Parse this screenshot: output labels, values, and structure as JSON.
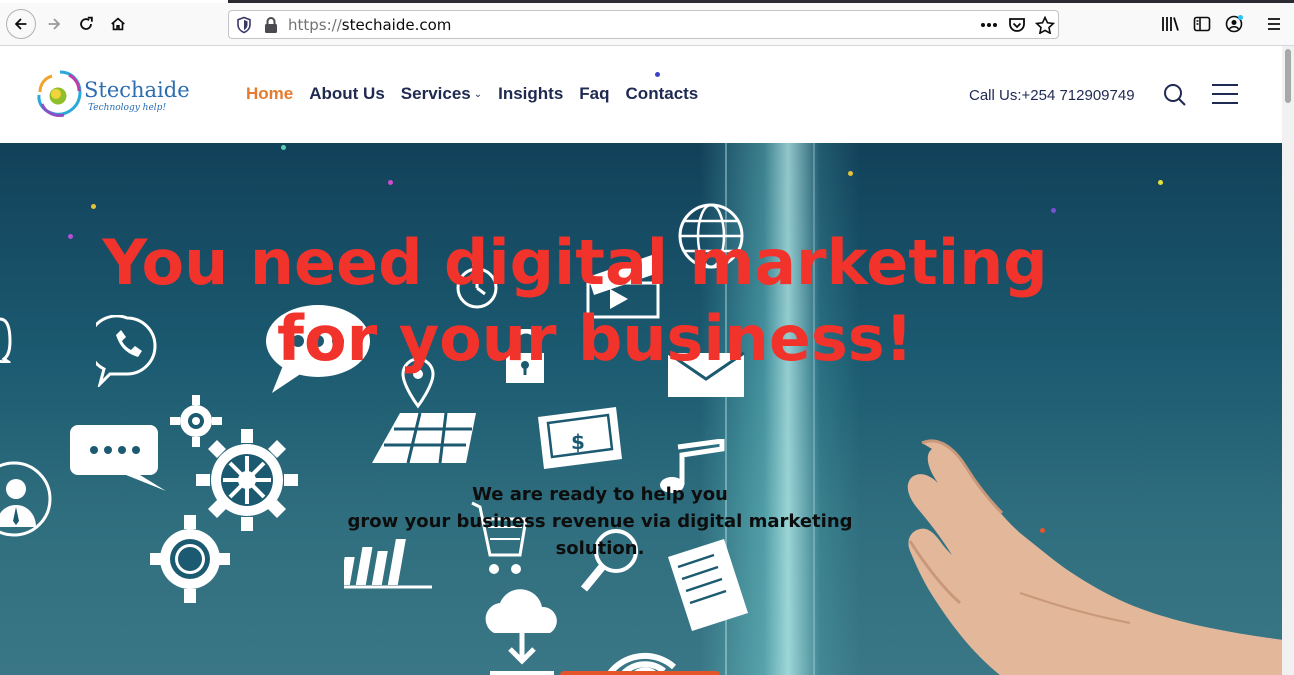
{
  "browser": {
    "url_protocol": "https://",
    "url_host": "stechaide.com"
  },
  "header": {
    "logo_name": "Stechaide",
    "logo_tagline": "Technology help!",
    "menu": [
      {
        "label": "Home",
        "active": true
      },
      {
        "label": "About Us"
      },
      {
        "label": "Services",
        "has_dropdown": true
      },
      {
        "label": "Insights"
      },
      {
        "label": "Faq"
      },
      {
        "label": "Contacts"
      }
    ],
    "call_text": "Call Us:+254 712909749"
  },
  "hero": {
    "title_line1": "You need digital marketing",
    "title_line2": "for your business!",
    "subtitle_line1": "We are ready to help you",
    "subtitle_line2": "grow your business revenue via digital marketing",
    "subtitle_line3": "solution."
  },
  "colors": {
    "accent_orange": "#e57b2e",
    "hero_title_red": "#f2332c",
    "nav_text": "#1f2a52"
  }
}
